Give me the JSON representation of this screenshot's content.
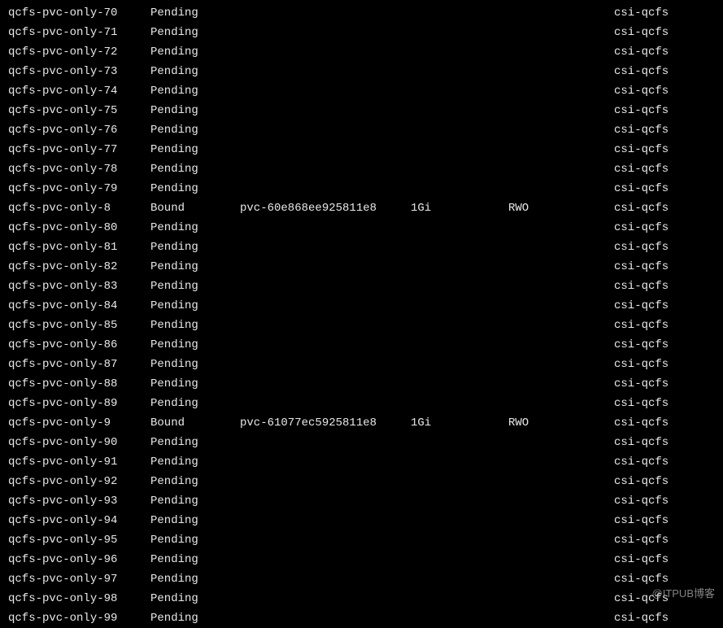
{
  "watermark": "@ITPUB博客",
  "rows": [
    {
      "name": "qcfs-pvc-only-70",
      "status": "Pending",
      "volume": "",
      "capacity": "",
      "access": "",
      "storageclass": "csi-qcfs"
    },
    {
      "name": "qcfs-pvc-only-71",
      "status": "Pending",
      "volume": "",
      "capacity": "",
      "access": "",
      "storageclass": "csi-qcfs"
    },
    {
      "name": "qcfs-pvc-only-72",
      "status": "Pending",
      "volume": "",
      "capacity": "",
      "access": "",
      "storageclass": "csi-qcfs"
    },
    {
      "name": "qcfs-pvc-only-73",
      "status": "Pending",
      "volume": "",
      "capacity": "",
      "access": "",
      "storageclass": "csi-qcfs"
    },
    {
      "name": "qcfs-pvc-only-74",
      "status": "Pending",
      "volume": "",
      "capacity": "",
      "access": "",
      "storageclass": "csi-qcfs"
    },
    {
      "name": "qcfs-pvc-only-75",
      "status": "Pending",
      "volume": "",
      "capacity": "",
      "access": "",
      "storageclass": "csi-qcfs"
    },
    {
      "name": "qcfs-pvc-only-76",
      "status": "Pending",
      "volume": "",
      "capacity": "",
      "access": "",
      "storageclass": "csi-qcfs"
    },
    {
      "name": "qcfs-pvc-only-77",
      "status": "Pending",
      "volume": "",
      "capacity": "",
      "access": "",
      "storageclass": "csi-qcfs"
    },
    {
      "name": "qcfs-pvc-only-78",
      "status": "Pending",
      "volume": "",
      "capacity": "",
      "access": "",
      "storageclass": "csi-qcfs"
    },
    {
      "name": "qcfs-pvc-only-79",
      "status": "Pending",
      "volume": "",
      "capacity": "",
      "access": "",
      "storageclass": "csi-qcfs"
    },
    {
      "name": "qcfs-pvc-only-8",
      "status": "Bound",
      "volume": "pvc-60e868ee925811e8",
      "capacity": "1Gi",
      "access": "RWO",
      "storageclass": "csi-qcfs"
    },
    {
      "name": "qcfs-pvc-only-80",
      "status": "Pending",
      "volume": "",
      "capacity": "",
      "access": "",
      "storageclass": "csi-qcfs"
    },
    {
      "name": "qcfs-pvc-only-81",
      "status": "Pending",
      "volume": "",
      "capacity": "",
      "access": "",
      "storageclass": "csi-qcfs"
    },
    {
      "name": "qcfs-pvc-only-82",
      "status": "Pending",
      "volume": "",
      "capacity": "",
      "access": "",
      "storageclass": "csi-qcfs"
    },
    {
      "name": "qcfs-pvc-only-83",
      "status": "Pending",
      "volume": "",
      "capacity": "",
      "access": "",
      "storageclass": "csi-qcfs"
    },
    {
      "name": "qcfs-pvc-only-84",
      "status": "Pending",
      "volume": "",
      "capacity": "",
      "access": "",
      "storageclass": "csi-qcfs"
    },
    {
      "name": "qcfs-pvc-only-85",
      "status": "Pending",
      "volume": "",
      "capacity": "",
      "access": "",
      "storageclass": "csi-qcfs"
    },
    {
      "name": "qcfs-pvc-only-86",
      "status": "Pending",
      "volume": "",
      "capacity": "",
      "access": "",
      "storageclass": "csi-qcfs"
    },
    {
      "name": "qcfs-pvc-only-87",
      "status": "Pending",
      "volume": "",
      "capacity": "",
      "access": "",
      "storageclass": "csi-qcfs"
    },
    {
      "name": "qcfs-pvc-only-88",
      "status": "Pending",
      "volume": "",
      "capacity": "",
      "access": "",
      "storageclass": "csi-qcfs"
    },
    {
      "name": "qcfs-pvc-only-89",
      "status": "Pending",
      "volume": "",
      "capacity": "",
      "access": "",
      "storageclass": "csi-qcfs"
    },
    {
      "name": "qcfs-pvc-only-9",
      "status": "Bound",
      "volume": "pvc-61077ec5925811e8",
      "capacity": "1Gi",
      "access": "RWO",
      "storageclass": "csi-qcfs"
    },
    {
      "name": "qcfs-pvc-only-90",
      "status": "Pending",
      "volume": "",
      "capacity": "",
      "access": "",
      "storageclass": "csi-qcfs"
    },
    {
      "name": "qcfs-pvc-only-91",
      "status": "Pending",
      "volume": "",
      "capacity": "",
      "access": "",
      "storageclass": "csi-qcfs"
    },
    {
      "name": "qcfs-pvc-only-92",
      "status": "Pending",
      "volume": "",
      "capacity": "",
      "access": "",
      "storageclass": "csi-qcfs"
    },
    {
      "name": "qcfs-pvc-only-93",
      "status": "Pending",
      "volume": "",
      "capacity": "",
      "access": "",
      "storageclass": "csi-qcfs"
    },
    {
      "name": "qcfs-pvc-only-94",
      "status": "Pending",
      "volume": "",
      "capacity": "",
      "access": "",
      "storageclass": "csi-qcfs"
    },
    {
      "name": "qcfs-pvc-only-95",
      "status": "Pending",
      "volume": "",
      "capacity": "",
      "access": "",
      "storageclass": "csi-qcfs"
    },
    {
      "name": "qcfs-pvc-only-96",
      "status": "Pending",
      "volume": "",
      "capacity": "",
      "access": "",
      "storageclass": "csi-qcfs"
    },
    {
      "name": "qcfs-pvc-only-97",
      "status": "Pending",
      "volume": "",
      "capacity": "",
      "access": "",
      "storageclass": "csi-qcfs"
    },
    {
      "name": "qcfs-pvc-only-98",
      "status": "Pending",
      "volume": "",
      "capacity": "",
      "access": "",
      "storageclass": "csi-qcfs"
    },
    {
      "name": "qcfs-pvc-only-99",
      "status": "Pending",
      "volume": "",
      "capacity": "",
      "access": "",
      "storageclass": "csi-qcfs"
    }
  ]
}
